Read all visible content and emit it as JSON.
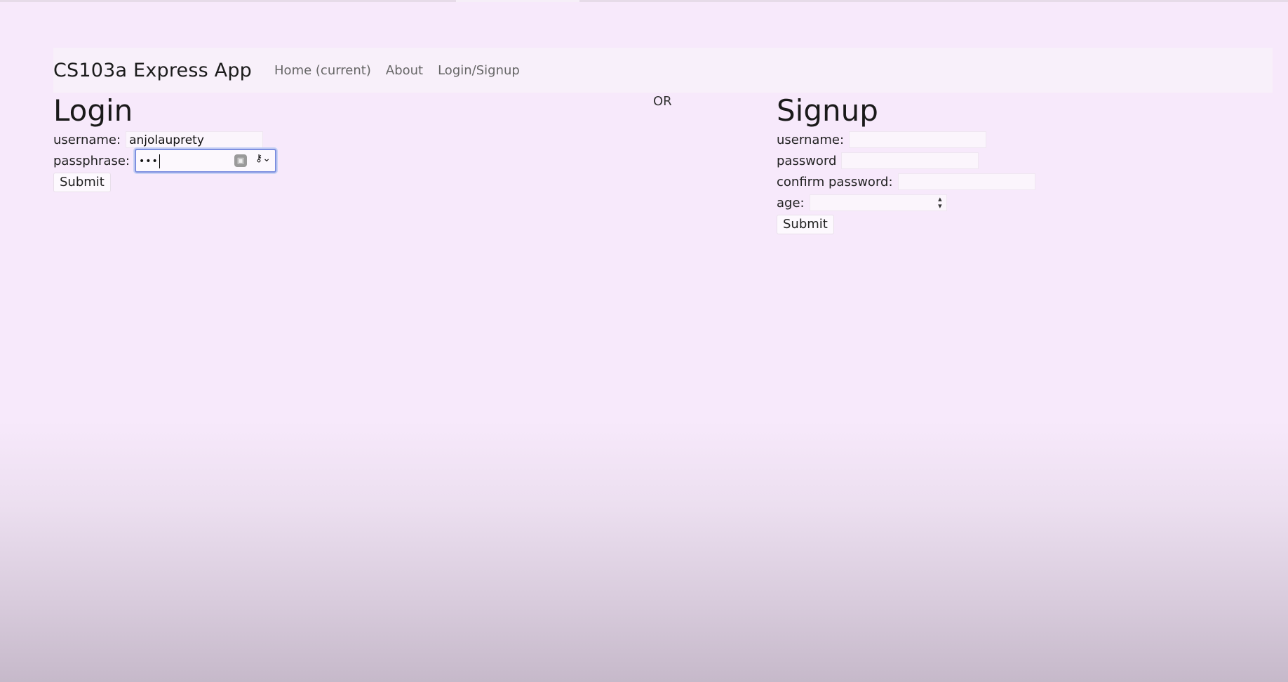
{
  "navbar": {
    "brand": "CS103a Express App",
    "links": [
      "Home (current)",
      "About",
      "Login/Signup"
    ]
  },
  "separator": "OR",
  "login": {
    "title": "Login",
    "username_label": "username:",
    "username_value": "anjolauprety",
    "passphrase_label": "passphrase:",
    "passphrase_value": "•••",
    "submit_label": "Submit"
  },
  "signup": {
    "title": "Signup",
    "username_label": "username:",
    "password_label": "password",
    "confirm_label": "confirm password:",
    "age_label": "age:",
    "submit_label": "Submit"
  },
  "icons": {
    "keychain": "keychain-icon",
    "key": "key-dropdown-icon",
    "spinner": "number-spinner-icon"
  },
  "colors": {
    "background": "#f7e9fb",
    "navbar": "#f8f0fa",
    "focus_ring": "#7d8fe0"
  }
}
